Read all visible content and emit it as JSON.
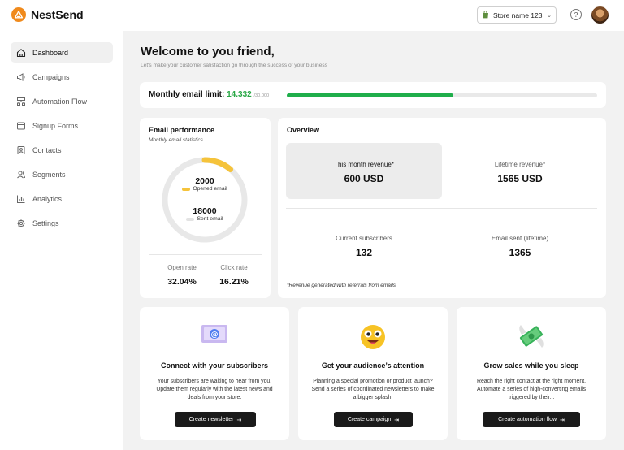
{
  "app": {
    "name": "NestSend"
  },
  "header": {
    "store_name": "Store name 123",
    "help_icon": "help-circle-icon"
  },
  "sidebar": {
    "items": [
      {
        "label": "Dashboard",
        "icon": "home-icon",
        "active": true
      },
      {
        "label": "Campaigns",
        "icon": "megaphone-icon",
        "active": false
      },
      {
        "label": "Automation Flow",
        "icon": "flow-icon",
        "active": false
      },
      {
        "label": "Signup Forms",
        "icon": "form-icon",
        "active": false
      },
      {
        "label": "Contacts",
        "icon": "contacts-icon",
        "active": false
      },
      {
        "label": "Segments",
        "icon": "segments-icon",
        "active": false
      },
      {
        "label": "Analytics",
        "icon": "analytics-icon",
        "active": false
      },
      {
        "label": "Settings",
        "icon": "settings-icon",
        "active": false
      }
    ]
  },
  "welcome": {
    "title": "Welcome to you friend,",
    "subtitle": "Let's make your customer satisfaction go through the success of your business"
  },
  "email_limit": {
    "label": "Monthly email limit:",
    "used": "14.332",
    "total": "/30.000",
    "progress_fraction": 0.5378
  },
  "email_performance": {
    "title": "Email performance",
    "subtitle": "Monthly email statistics",
    "opened": {
      "value": "2000",
      "label": "Opened email",
      "color": "#f5c33b"
    },
    "sent": {
      "value": "18000",
      "label": "Sent email",
      "color": "#e8e8e8"
    },
    "opened_fraction": 0.111,
    "open_rate": {
      "label": "Open rate",
      "value": "32.04%"
    },
    "click_rate": {
      "label": "Click rate",
      "value": "16.21%"
    }
  },
  "overview": {
    "title": "Overview",
    "month_revenue": {
      "label": "This month revenue*",
      "value": "600 USD"
    },
    "lifetime_revenue": {
      "label": "Lifetime revenue*",
      "value": "1565 USD"
    },
    "current_subscribers": {
      "label": "Current subscribers",
      "value": "132"
    },
    "emails_sent": {
      "label": "Email sent (lifetime)",
      "value": "1365"
    },
    "note": "*Revenue generated with referrals from emails"
  },
  "promos": [
    {
      "icon": "at-email-icon",
      "title": "Connect with your subscribers",
      "body": "Your subscribers are waiting to hear from you. Update them regularly with the latest news and deals from your store.",
      "button": "Create newsletter"
    },
    {
      "icon": "smiling-face-icon",
      "title": "Get your audience’s attention",
      "body": "Planning a special promotion or product launch? Send a series of coordinated newsletters to make a bigger splash.",
      "button": "Create campaign"
    },
    {
      "icon": "money-with-wings-icon",
      "title": "Grow sales while you sleep",
      "body": "Reach the right contact at the right moment. Automate a series of high-converting emails triggered by their...",
      "button": "Create automation flow"
    }
  ],
  "colors": {
    "accent_green": "#28a745",
    "brand_orange": "#f08a1c",
    "ring_yellow": "#f5c33b"
  }
}
